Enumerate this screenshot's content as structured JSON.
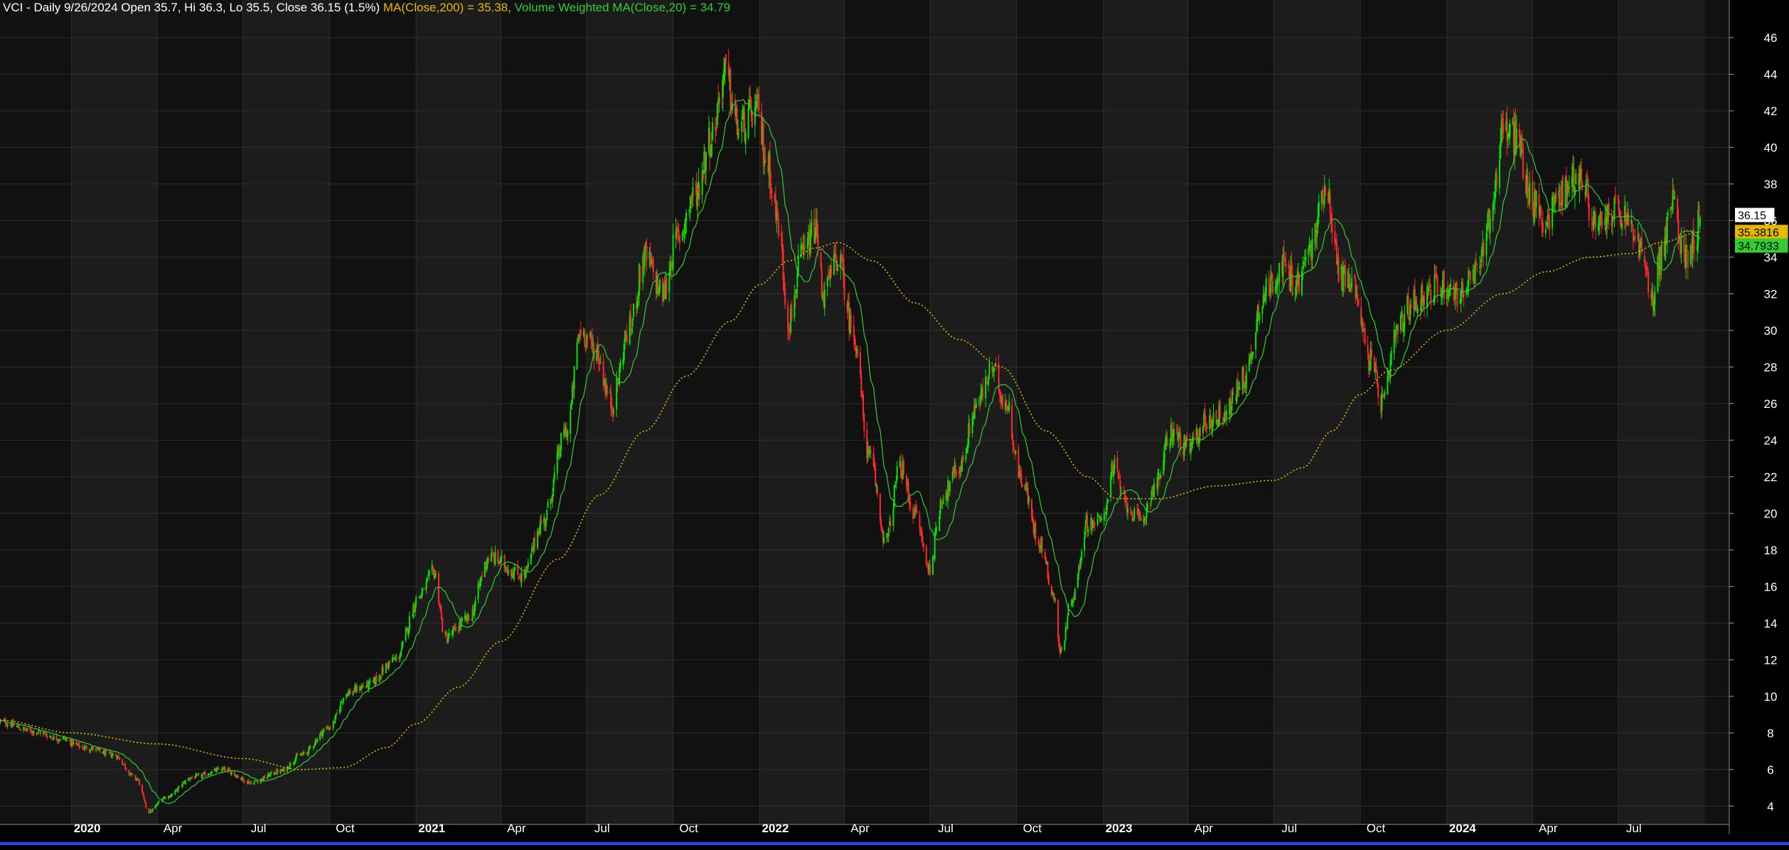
{
  "header": {
    "symbol_line": "VCI - Daily 9/26/2024 Open 35.7, Hi 36.3, Lo 35.5, Close 36.15 (1.5%)",
    "ma_label": "MA(Close,200) = 35.38,",
    "vwma_label": "Volume Weighted MA(Close,20) = 34.79"
  },
  "colors": {
    "background": "#000000",
    "band_light": "#1c1c1c",
    "band_dark": "#111111",
    "grid": "#2e2e2e",
    "up_candle": "#00e600",
    "down_candle": "#ff2a2a",
    "ma200": "#e6b800",
    "vwma20": "#33cc33",
    "axis_text": "#ffffff",
    "bottom_line": "#2a3fff"
  },
  "chart_data": {
    "type": "candlestick",
    "title": "VCI - Daily 9/26/2024",
    "y_ticks": [
      4,
      6,
      8,
      10,
      12,
      14,
      16,
      18,
      20,
      22,
      24,
      26,
      28,
      30,
      32,
      34,
      36,
      38,
      40,
      42,
      44,
      46
    ],
    "ylim": [
      3,
      47.2
    ],
    "x_ticks": [
      "2020-01-01",
      "2020-04-01",
      "2020-07-01",
      "2020-10-01",
      "2021-01-01",
      "2021-04-01",
      "2021-07-01",
      "2021-10-01",
      "2022-01-01",
      "2022-04-01",
      "2022-07-01",
      "2022-10-01",
      "2023-01-01",
      "2023-04-01",
      "2023-07-01",
      "2023-10-01",
      "2024-01-01",
      "2024-04-01",
      "2024-07-01"
    ],
    "x_tick_labels": [
      "2020",
      "Apr",
      "Jul",
      "Oct",
      "2021",
      "Apr",
      "Jul",
      "Oct",
      "2022",
      "Apr",
      "Jul",
      "Oct",
      "2023",
      "Apr",
      "Jul",
      "Oct",
      "2024",
      "Apr",
      "Jul"
    ],
    "bold_tick_labels": [
      "2020",
      "2021",
      "2022",
      "2023",
      "2024"
    ],
    "xlim": [
      "2019-10-17",
      "2024-10-27"
    ],
    "last_bar": {
      "date": "2024-09-26",
      "open": 35.7,
      "high": 36.3,
      "low": 35.5,
      "close": 36.15
    },
    "price_anchors": [
      [
        "2019-10-17",
        8.6
      ],
      [
        "2019-11-20",
        8.1
      ],
      [
        "2019-12-20",
        7.7
      ],
      [
        "2020-01-15",
        7.2
      ],
      [
        "2020-02-15",
        6.8
      ],
      [
        "2020-03-10",
        5.5
      ],
      [
        "2020-03-23",
        3.7
      ],
      [
        "2020-04-10",
        4.5
      ],
      [
        "2020-05-10",
        5.6
      ],
      [
        "2020-06-10",
        6.0
      ],
      [
        "2020-07-10",
        5.3
      ],
      [
        "2020-08-10",
        5.9
      ],
      [
        "2020-09-01",
        6.8
      ],
      [
        "2020-10-01",
        8.3
      ],
      [
        "2020-10-20",
        10.2
      ],
      [
        "2020-11-10",
        10.6
      ],
      [
        "2020-12-10",
        12.0
      ],
      [
        "2021-01-05",
        15.5
      ],
      [
        "2021-01-20",
        16.8
      ],
      [
        "2021-02-01",
        13.2
      ],
      [
        "2021-02-25",
        14.2
      ],
      [
        "2021-03-20",
        17.6
      ],
      [
        "2021-04-25",
        16.6
      ],
      [
        "2021-05-15",
        19.5
      ],
      [
        "2021-06-10",
        24.5
      ],
      [
        "2021-06-25",
        30.0
      ],
      [
        "2021-07-10",
        29.0
      ],
      [
        "2021-07-28",
        26.0
      ],
      [
        "2021-08-15",
        30.0
      ],
      [
        "2021-09-01",
        34.0
      ],
      [
        "2021-09-20",
        32.0
      ],
      [
        "2021-10-05",
        35.0
      ],
      [
        "2021-10-25",
        37.5
      ],
      [
        "2021-11-10",
        40.5
      ],
      [
        "2021-11-25",
        44.0
      ],
      [
        "2021-12-10",
        41.0
      ],
      [
        "2021-12-28",
        42.0
      ],
      [
        "2022-01-10",
        39.0
      ],
      [
        "2022-01-20",
        36.0
      ],
      [
        "2022-02-01",
        30.5
      ],
      [
        "2022-02-15",
        34.0
      ],
      [
        "2022-03-01",
        35.5
      ],
      [
        "2022-03-10",
        32.0
      ],
      [
        "2022-03-25",
        34.0
      ],
      [
        "2022-04-10",
        30.0
      ],
      [
        "2022-04-28",
        23.0
      ],
      [
        "2022-05-15",
        18.5
      ],
      [
        "2022-05-30",
        22.5
      ],
      [
        "2022-06-15",
        20.0
      ],
      [
        "2022-06-30",
        17.0
      ],
      [
        "2022-07-15",
        21.0
      ],
      [
        "2022-08-01",
        22.5
      ],
      [
        "2022-08-20",
        26.0
      ],
      [
        "2022-09-05",
        27.8
      ],
      [
        "2022-09-20",
        26.0
      ],
      [
        "2022-10-05",
        22.0
      ],
      [
        "2022-10-25",
        18.5
      ],
      [
        "2022-11-10",
        15.5
      ],
      [
        "2022-11-16",
        12.4
      ],
      [
        "2022-11-30",
        15.5
      ],
      [
        "2022-12-15",
        19.5
      ],
      [
        "2022-12-30",
        19.5
      ],
      [
        "2023-01-12",
        22.5
      ],
      [
        "2023-01-25",
        20.5
      ],
      [
        "2023-02-10",
        19.5
      ],
      [
        "2023-02-25",
        21.5
      ],
      [
        "2023-03-15",
        24.5
      ],
      [
        "2023-04-01",
        23.5
      ],
      [
        "2023-04-20",
        25.0
      ],
      [
        "2023-05-10",
        25.5
      ],
      [
        "2023-06-01",
        27.5
      ],
      [
        "2023-06-20",
        32.0
      ],
      [
        "2023-07-10",
        33.5
      ],
      [
        "2023-07-25",
        32.5
      ],
      [
        "2023-08-10",
        34.5
      ],
      [
        "2023-08-25",
        38.0
      ],
      [
        "2023-09-10",
        33.0
      ],
      [
        "2023-09-25",
        32.5
      ],
      [
        "2023-10-10",
        28.5
      ],
      [
        "2023-10-25",
        26.0
      ],
      [
        "2023-11-10",
        30.0
      ],
      [
        "2023-11-25",
        31.5
      ],
      [
        "2023-12-10",
        32.0
      ],
      [
        "2023-12-25",
        32.5
      ],
      [
        "2024-01-15",
        32.0
      ],
      [
        "2024-02-01",
        33.0
      ],
      [
        "2024-02-15",
        36.0
      ],
      [
        "2024-03-01",
        41.0
      ],
      [
        "2024-03-15",
        40.5
      ],
      [
        "2024-04-01",
        37.0
      ],
      [
        "2024-04-15",
        36.0
      ],
      [
        "2024-05-01",
        37.5
      ],
      [
        "2024-05-20",
        38.5
      ],
      [
        "2024-06-10",
        35.5
      ],
      [
        "2024-06-25",
        36.5
      ],
      [
        "2024-07-10",
        36.0
      ],
      [
        "2024-07-25",
        34.5
      ],
      [
        "2024-08-05",
        31.5
      ],
      [
        "2024-08-15",
        34.0
      ],
      [
        "2024-08-28",
        37.0
      ],
      [
        "2024-09-10",
        34.0
      ],
      [
        "2024-09-20",
        35.0
      ],
      [
        "2024-09-26",
        36.15
      ]
    ],
    "ma200_anchors": [
      [
        "2019-10-17",
        8.7
      ],
      [
        "2020-01-01",
        8.0
      ],
      [
        "2020-04-01",
        7.4
      ],
      [
        "2020-07-01",
        6.6
      ],
      [
        "2020-09-01",
        6.0
      ],
      [
        "2020-10-15",
        6.1
      ],
      [
        "2020-12-01",
        7.2
      ],
      [
        "2021-01-01",
        8.5
      ],
      [
        "2021-02-15",
        10.5
      ],
      [
        "2021-04-01",
        13.0
      ],
      [
        "2021-06-01",
        17.5
      ],
      [
        "2021-07-15",
        21.0
      ],
      [
        "2021-09-01",
        24.5
      ],
      [
        "2021-10-15",
        27.5
      ],
      [
        "2021-12-01",
        30.5
      ],
      [
        "2022-01-01",
        32.5
      ],
      [
        "2022-02-01",
        33.8
      ],
      [
        "2022-03-01",
        34.5
      ],
      [
        "2022-03-25",
        34.8
      ],
      [
        "2022-05-01",
        33.8
      ],
      [
        "2022-06-15",
        31.5
      ],
      [
        "2022-08-01",
        29.5
      ],
      [
        "2022-09-15",
        28.0
      ],
      [
        "2022-11-01",
        24.5
      ],
      [
        "2022-12-15",
        22.0
      ],
      [
        "2023-01-15",
        20.8
      ],
      [
        "2023-03-01",
        20.8
      ],
      [
        "2023-05-01",
        21.5
      ],
      [
        "2023-07-01",
        21.8
      ],
      [
        "2023-08-01",
        22.5
      ],
      [
        "2023-09-01",
        24.5
      ],
      [
        "2023-10-01",
        26.5
      ],
      [
        "2023-11-01",
        27.8
      ],
      [
        "2024-01-01",
        30.0
      ],
      [
        "2024-03-01",
        32.0
      ],
      [
        "2024-04-15",
        33.2
      ],
      [
        "2024-06-01",
        34.0
      ],
      [
        "2024-07-15",
        34.2
      ],
      [
        "2024-08-15",
        34.8
      ],
      [
        "2024-09-26",
        35.38
      ]
    ],
    "vwma20_last": 34.79,
    "price_labels": [
      {
        "value": 36.15,
        "text": "36.15",
        "bg": "#ffffff",
        "fg": "#000000"
      },
      {
        "value": 35.38,
        "text": "35.3816",
        "bg": "#e6b800",
        "fg": "#000000"
      },
      {
        "value": 34.79,
        "text": "34.7933",
        "bg": "#33cc33",
        "fg": "#000000"
      }
    ]
  }
}
